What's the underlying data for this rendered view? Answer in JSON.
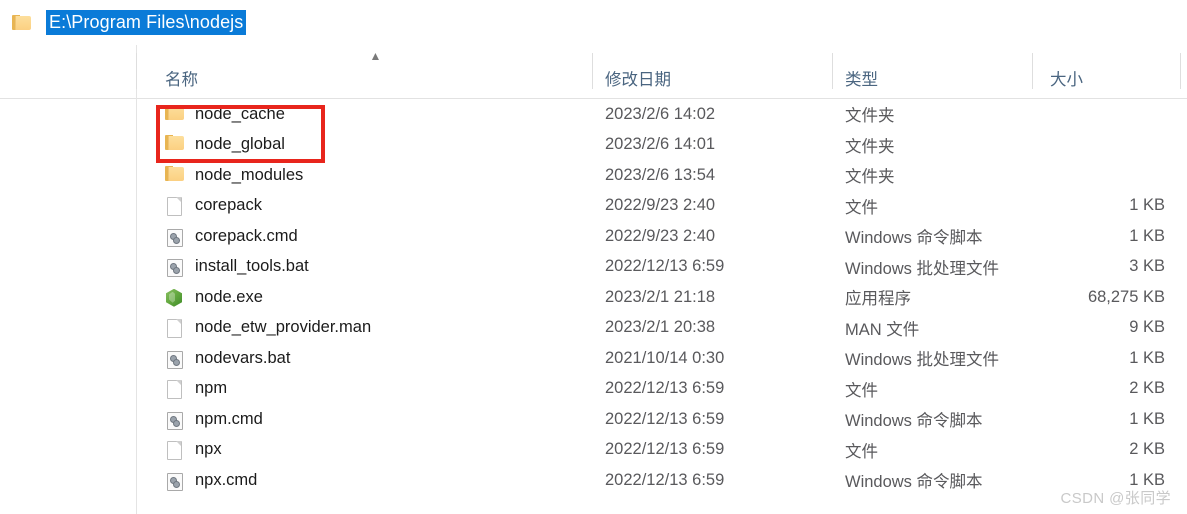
{
  "window": {
    "address_bar": {
      "folder_icon": "folder-icon",
      "path": "E:\\Program Files\\nodejs"
    }
  },
  "columns": {
    "name": "名称",
    "date_modified": "修改日期",
    "type": "类型",
    "size": "大小",
    "sort_indicator": "▲",
    "sort_column": "名称",
    "sort_direction": "ascending"
  },
  "files": [
    {
      "icon": "folder-icon",
      "name": "node_cache",
      "date": "2023/2/6 14:02",
      "type": "文件夹",
      "size": ""
    },
    {
      "icon": "folder-icon",
      "name": "node_global",
      "date": "2023/2/6 14:01",
      "type": "文件夹",
      "size": ""
    },
    {
      "icon": "folder-icon",
      "name": "node_modules",
      "date": "2023/2/6 13:54",
      "type": "文件夹",
      "size": ""
    },
    {
      "icon": "document-icon",
      "name": "corepack",
      "date": "2022/9/23 2:40",
      "type": "文件",
      "size": "1 KB"
    },
    {
      "icon": "script-icon",
      "name": "corepack.cmd",
      "date": "2022/9/23 2:40",
      "type": "Windows 命令脚本",
      "size": "1 KB"
    },
    {
      "icon": "script-icon",
      "name": "install_tools.bat",
      "date": "2022/12/13 6:59",
      "type": "Windows 批处理文件",
      "size": "3 KB"
    },
    {
      "icon": "node-icon",
      "name": "node.exe",
      "date": "2023/2/1 21:18",
      "type": "应用程序",
      "size": "68,275 KB"
    },
    {
      "icon": "document-icon",
      "name": "node_etw_provider.man",
      "date": "2023/2/1 20:38",
      "type": "MAN 文件",
      "size": "9 KB"
    },
    {
      "icon": "script-icon",
      "name": "nodevars.bat",
      "date": "2021/10/14 0:30",
      "type": "Windows 批处理文件",
      "size": "1 KB"
    },
    {
      "icon": "document-icon",
      "name": "npm",
      "date": "2022/12/13 6:59",
      "type": "文件",
      "size": "2 KB"
    },
    {
      "icon": "script-icon",
      "name": "npm.cmd",
      "date": "2022/12/13 6:59",
      "type": "Windows 命令脚本",
      "size": "1 KB"
    },
    {
      "icon": "document-icon",
      "name": "npx",
      "date": "2022/12/13 6:59",
      "type": "文件",
      "size": "2 KB"
    },
    {
      "icon": "script-icon",
      "name": "npx.cmd",
      "date": "2022/12/13 6:59",
      "type": "Windows 命令脚本",
      "size": "1 KB"
    }
  ],
  "annotation": {
    "highlight_color": "#e8251c",
    "covers": [
      "node_cache",
      "node_global"
    ]
  },
  "watermark": {
    "text": "CSDN @张同学"
  },
  "colors": {
    "selection_blue": "#0a7bd8",
    "header_text": "#4a6580",
    "folder_yellow": "#fbd082",
    "node_green": "#63a83f"
  }
}
